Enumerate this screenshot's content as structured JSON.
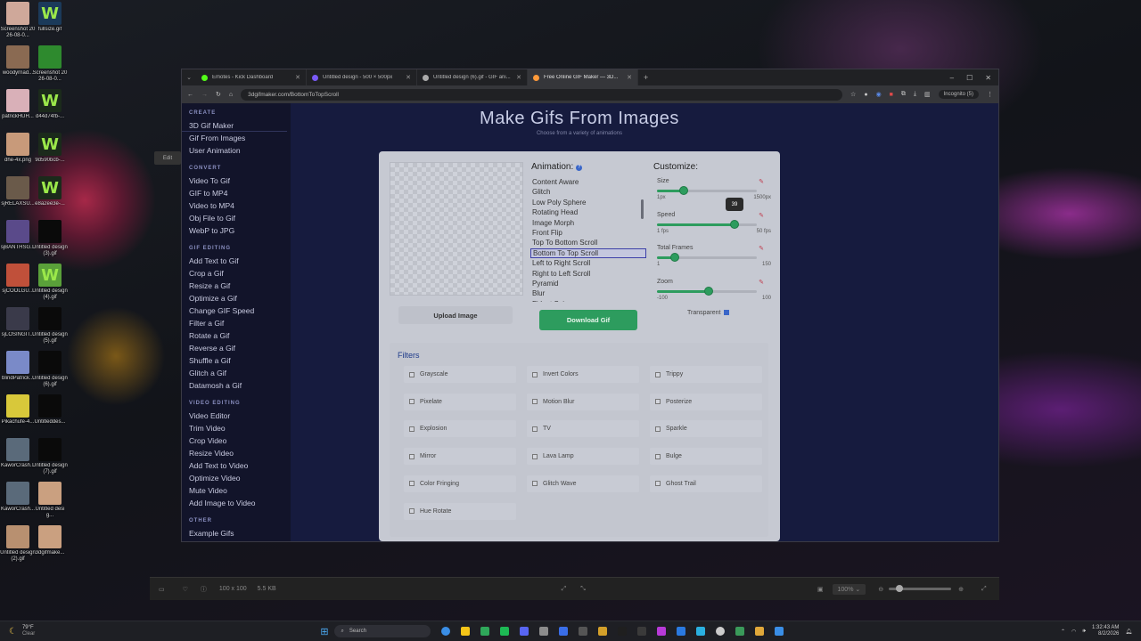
{
  "desktop_icons": [
    {
      "label": "Screenshot 2026-08-0...",
      "color": "#cfa89a",
      "glyph": ""
    },
    {
      "label": "fullsize.gif",
      "color": "#1b3a5a",
      "glyph": "W"
    },
    {
      "label": "woodyrnad...",
      "color": "#8a6a52",
      "glyph": ""
    },
    {
      "label": "Screenshot 2026-08-0...",
      "color": "#2e8a2e",
      "glyph": ""
    },
    {
      "label": "patrickHUH...",
      "color": "#d9b0b8",
      "glyph": ""
    },
    {
      "label": "d44d74fb-...",
      "color": "#1b2a1b",
      "glyph": "W"
    },
    {
      "label": "dhe-4x.png",
      "color": "#c89a7a",
      "glyph": ""
    },
    {
      "label": "9d590bcb-...",
      "color": "#1b2a1b",
      "glyph": "W"
    },
    {
      "label": "sjRELAXSU...",
      "color": "#6a5a4a",
      "glyph": ""
    },
    {
      "label": "e8a2ee3e-...",
      "color": "#1b2a1b",
      "glyph": "W"
    },
    {
      "label": "sjBANTHSG...",
      "color": "#5a4a8a",
      "glyph": ""
    },
    {
      "label": "Untitled design (3).gif",
      "color": "#0a0a0a",
      "glyph": ""
    },
    {
      "label": "sjCOOLGU...",
      "color": "#c0503a",
      "glyph": ""
    },
    {
      "label": "Untitled design (4).gif",
      "color": "#5aa03a",
      "glyph": "W"
    },
    {
      "label": "sjLOSINGIT...",
      "color": "#3a3a4a",
      "glyph": ""
    },
    {
      "label": "Untitled design (5).gif",
      "color": "#0a0a0a",
      "glyph": ""
    },
    {
      "label": "blindPatrick...",
      "color": "#7a8ac8",
      "glyph": ""
    },
    {
      "label": "Untitled design (6).gif",
      "color": "#0a0a0a",
      "glyph": ""
    },
    {
      "label": "Pikachufe-4...",
      "color": "#d8c83a",
      "glyph": ""
    },
    {
      "label": "Untitleddes...",
      "color": "#0a0a0a",
      "glyph": ""
    },
    {
      "label": "KaworCrash...",
      "color": "#5a6a7a",
      "glyph": ""
    },
    {
      "label": "Untitled design (7).gif",
      "color": "#0a0a0a",
      "glyph": ""
    },
    {
      "label": "KaworCrash...",
      "color": "#5a6a7a",
      "glyph": ""
    },
    {
      "label": "Untitled desig...",
      "color": "#caa080",
      "glyph": ""
    },
    {
      "label": "Untitled design (2).gif",
      "color": "#b89070",
      "glyph": ""
    },
    {
      "label": "3dgifmake...",
      "color": "#caa080",
      "glyph": ""
    }
  ],
  "browser": {
    "tabs": [
      {
        "title": "Emotes - Kick Dashboard",
        "color": "#53fc18"
      },
      {
        "title": "Untitled design - 500 × 500px",
        "color": "#7a5af8"
      },
      {
        "title": "Untitled design (6).gif - GIF ani...",
        "color": "#aaaaaa"
      },
      {
        "title": "Free Online GIF Maker — 3D...",
        "color": "#ff9a3a"
      }
    ],
    "new_tab": "+",
    "url": "3dgifmaker.com/BottomToTopScroll",
    "incognito": "Incognito (5)"
  },
  "sidebar": {
    "sections": [
      {
        "title": "CREATE",
        "items": [
          "3D Gif Maker",
          "Gif From Images",
          "User Animation"
        ]
      },
      {
        "title": "CONVERT",
        "items": [
          "Video To Gif",
          "GIF to MP4",
          "Video to MP4",
          "Obj File to Gif",
          "WebP to JPG"
        ]
      },
      {
        "title": "GIF EDITING",
        "items": [
          "Add Text to Gif",
          "Crop a Gif",
          "Resize a Gif",
          "Optimize a Gif",
          "Change GIF Speed",
          "Filter a Gif",
          "Rotate a Gif",
          "Reverse a Gif",
          "Shuffle a Gif",
          "Glitch a Gif",
          "Datamosh a Gif"
        ]
      },
      {
        "title": "VIDEO EDITING",
        "items": [
          "Video Editor",
          "Trim Video",
          "Crop Video",
          "Resize Video",
          "Add Text to Video",
          "Optimize Video",
          "Mute Video",
          "Add Image to Video"
        ]
      },
      {
        "title": "OTHER",
        "items": [
          "Example Gifs"
        ]
      }
    ]
  },
  "header": {
    "title": "Make Gifs From Images",
    "subtitle": "Choose from a variety of animations"
  },
  "card": {
    "upload_label": "Upload Image",
    "animation_label": "Animation:",
    "animations": [
      "Content Aware",
      "Glitch",
      "Low Poly Sphere",
      "Rotating Head",
      "Image Morph",
      "Front Flip",
      "Top To Bottom Scroll",
      "Bottom To Top Scroll",
      "Left to Right Scroll",
      "Right to Left Scroll",
      "Pyramid",
      "Blur",
      "Fidget Spinner"
    ],
    "selected_animation": "Bottom To Top Scroll",
    "download_label": "Download Gif",
    "customize_label": "Customize:",
    "sliders": [
      {
        "name": "Size",
        "min_label": "1px",
        "max_label": "1500px",
        "fraction": 0.27
      },
      {
        "name": "Speed",
        "min_label": "1 fps",
        "max_label": "50 fps",
        "fraction": 0.78,
        "tooltip": "39"
      },
      {
        "name": "Total Frames",
        "min_label": "1",
        "max_label": "150",
        "fraction": 0.18
      },
      {
        "name": "Zoom",
        "min_label": "-100",
        "max_label": "100",
        "fraction": 0.52
      }
    ],
    "transparent_label": "Transparent",
    "transparent_checked": true,
    "filters_title": "Filters",
    "filters": [
      "Grayscale",
      "Invert Colors",
      "Trippy",
      "Pixelate",
      "Motion Blur",
      "Posterize",
      "Explosion",
      "TV",
      "Sparkle",
      "Mirror",
      "Lava Lamp",
      "Bulge",
      "Color Fringing",
      "Glitch Wave",
      "Ghost Trail",
      "Hue Rotate"
    ]
  },
  "viewer": {
    "edit_label": "Edit",
    "dimensions": "100 x 100",
    "filesize": "5.5 KB",
    "zoom": "100%"
  },
  "taskbar": {
    "weather_temp": "79°F",
    "weather_desc": "Clear",
    "search": "Search",
    "time": "1:32:43 AM",
    "date": "8/2/2026",
    "apps": [
      "#3a8ee6",
      "#f5c518",
      "#2fa85a",
      "#1db954",
      "#5865f2",
      "#8c8c8c",
      "#3a6ee8",
      "#555555",
      "#d4a02a",
      "#1f1f1f",
      "#3a3a3a",
      "#b83ad8",
      "#2a7ae0",
      "#2ab0e0",
      "#cccccc",
      "#3a9a5a",
      "#e0a83a",
      "#3a8ee6"
    ]
  }
}
